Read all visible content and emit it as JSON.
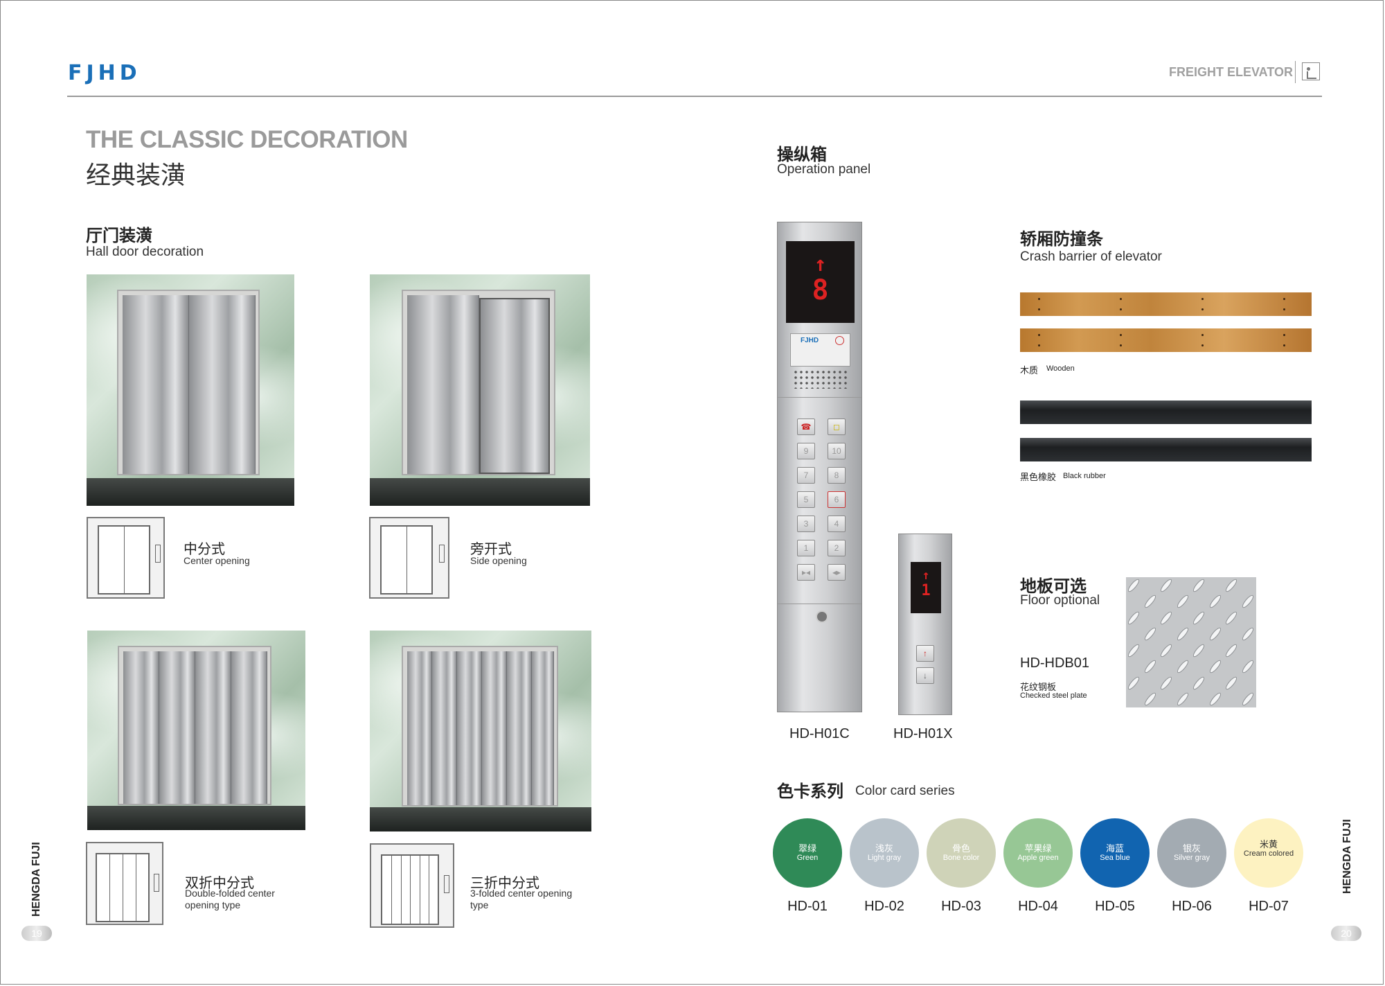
{
  "header": {
    "logo": "FJHD",
    "category": "FREIGHT ELEVATOR"
  },
  "title": {
    "en": "THE CLASSIC DECORATION",
    "cn": "经典装潢"
  },
  "hall_door": {
    "cn": "厅门装潢",
    "en": "Hall door decoration",
    "types": [
      {
        "cn": "中分式",
        "en": "Center opening"
      },
      {
        "cn": "旁开式",
        "en": "Side opening"
      },
      {
        "cn": "双折中分式",
        "en": "Double-folded center opening type"
      },
      {
        "cn": "三折中分式",
        "en": "3-folded center opening type"
      }
    ]
  },
  "operation_panel": {
    "cn": "操纵箱",
    "en": "Operation panel",
    "display_main": "8",
    "display_hall": "1",
    "plaque_brand": "FJHD",
    "models": [
      "HD-H01C",
      "HD-H01X"
    ],
    "buttons": [
      "9",
      "10",
      "7",
      "8",
      "5",
      "6",
      "3",
      "4",
      "1",
      "2"
    ]
  },
  "crash_barrier": {
    "cn": "轿厢防撞条",
    "en": "Crash barrier of elevator",
    "wooden_cn": "木质",
    "wooden_en": "Wooden",
    "rubber_cn": "黑色橡胶",
    "rubber_en": "Black rubber"
  },
  "floor": {
    "cn": "地板可选",
    "en": "Floor optional",
    "model": "HD-HDB01",
    "material_cn": "花纹钢板",
    "material_en": "Checked steel plate"
  },
  "color_card": {
    "cn": "色卡系列",
    "en": "Color card series",
    "colors": [
      {
        "cn": "翠绿",
        "en": "Green",
        "code": "HD-01",
        "hex": "#2f8a57"
      },
      {
        "cn": "浅灰",
        "en": "Light gray",
        "code": "HD-02",
        "hex": "#b9c3cb"
      },
      {
        "cn": "骨色",
        "en": "Bone color",
        "code": "HD-03",
        "hex": "#cfd3b8"
      },
      {
        "cn": "苹果绿",
        "en": "Apple green",
        "code": "HD-04",
        "hex": "#97c795"
      },
      {
        "cn": "海蓝",
        "en": "Sea blue",
        "code": "HD-05",
        "hex": "#1164b0"
      },
      {
        "cn": "银灰",
        "en": "Silver gray",
        "code": "HD-06",
        "hex": "#a3abb2"
      },
      {
        "cn": "米黄",
        "en": "Cream colored",
        "code": "HD-07",
        "hex": "#fdf2c1"
      }
    ]
  },
  "footer": {
    "side_text": "HENGDA FUJI",
    "page_left": "19",
    "page_right": "20"
  }
}
